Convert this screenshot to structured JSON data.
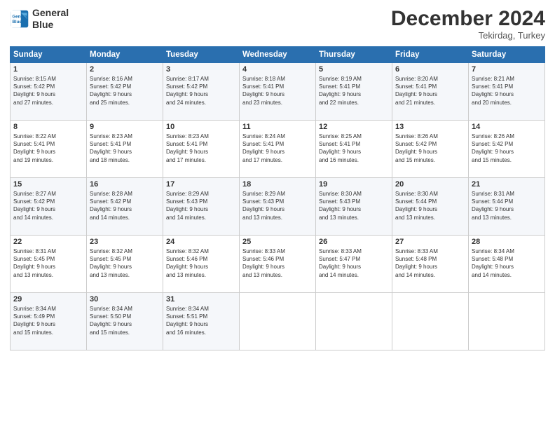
{
  "logo": {
    "line1": "General",
    "line2": "Blue"
  },
  "title": "December 2024",
  "location": "Tekirdag, Turkey",
  "days_header": [
    "Sunday",
    "Monday",
    "Tuesday",
    "Wednesday",
    "Thursday",
    "Friday",
    "Saturday"
  ],
  "weeks": [
    [
      {
        "day": "1",
        "text": "Sunrise: 8:15 AM\nSunset: 5:42 PM\nDaylight: 9 hours\nand 27 minutes."
      },
      {
        "day": "2",
        "text": "Sunrise: 8:16 AM\nSunset: 5:42 PM\nDaylight: 9 hours\nand 25 minutes."
      },
      {
        "day": "3",
        "text": "Sunrise: 8:17 AM\nSunset: 5:42 PM\nDaylight: 9 hours\nand 24 minutes."
      },
      {
        "day": "4",
        "text": "Sunrise: 8:18 AM\nSunset: 5:41 PM\nDaylight: 9 hours\nand 23 minutes."
      },
      {
        "day": "5",
        "text": "Sunrise: 8:19 AM\nSunset: 5:41 PM\nDaylight: 9 hours\nand 22 minutes."
      },
      {
        "day": "6",
        "text": "Sunrise: 8:20 AM\nSunset: 5:41 PM\nDaylight: 9 hours\nand 21 minutes."
      },
      {
        "day": "7",
        "text": "Sunrise: 8:21 AM\nSunset: 5:41 PM\nDaylight: 9 hours\nand 20 minutes."
      }
    ],
    [
      {
        "day": "8",
        "text": "Sunrise: 8:22 AM\nSunset: 5:41 PM\nDaylight: 9 hours\nand 19 minutes."
      },
      {
        "day": "9",
        "text": "Sunrise: 8:23 AM\nSunset: 5:41 PM\nDaylight: 9 hours\nand 18 minutes."
      },
      {
        "day": "10",
        "text": "Sunrise: 8:23 AM\nSunset: 5:41 PM\nDaylight: 9 hours\nand 17 minutes."
      },
      {
        "day": "11",
        "text": "Sunrise: 8:24 AM\nSunset: 5:41 PM\nDaylight: 9 hours\nand 17 minutes."
      },
      {
        "day": "12",
        "text": "Sunrise: 8:25 AM\nSunset: 5:41 PM\nDaylight: 9 hours\nand 16 minutes."
      },
      {
        "day": "13",
        "text": "Sunrise: 8:26 AM\nSunset: 5:42 PM\nDaylight: 9 hours\nand 15 minutes."
      },
      {
        "day": "14",
        "text": "Sunrise: 8:26 AM\nSunset: 5:42 PM\nDaylight: 9 hours\nand 15 minutes."
      }
    ],
    [
      {
        "day": "15",
        "text": "Sunrise: 8:27 AM\nSunset: 5:42 PM\nDaylight: 9 hours\nand 14 minutes."
      },
      {
        "day": "16",
        "text": "Sunrise: 8:28 AM\nSunset: 5:42 PM\nDaylight: 9 hours\nand 14 minutes."
      },
      {
        "day": "17",
        "text": "Sunrise: 8:29 AM\nSunset: 5:43 PM\nDaylight: 9 hours\nand 14 minutes."
      },
      {
        "day": "18",
        "text": "Sunrise: 8:29 AM\nSunset: 5:43 PM\nDaylight: 9 hours\nand 13 minutes."
      },
      {
        "day": "19",
        "text": "Sunrise: 8:30 AM\nSunset: 5:43 PM\nDaylight: 9 hours\nand 13 minutes."
      },
      {
        "day": "20",
        "text": "Sunrise: 8:30 AM\nSunset: 5:44 PM\nDaylight: 9 hours\nand 13 minutes."
      },
      {
        "day": "21",
        "text": "Sunrise: 8:31 AM\nSunset: 5:44 PM\nDaylight: 9 hours\nand 13 minutes."
      }
    ],
    [
      {
        "day": "22",
        "text": "Sunrise: 8:31 AM\nSunset: 5:45 PM\nDaylight: 9 hours\nand 13 minutes."
      },
      {
        "day": "23",
        "text": "Sunrise: 8:32 AM\nSunset: 5:45 PM\nDaylight: 9 hours\nand 13 minutes."
      },
      {
        "day": "24",
        "text": "Sunrise: 8:32 AM\nSunset: 5:46 PM\nDaylight: 9 hours\nand 13 minutes."
      },
      {
        "day": "25",
        "text": "Sunrise: 8:33 AM\nSunset: 5:46 PM\nDaylight: 9 hours\nand 13 minutes."
      },
      {
        "day": "26",
        "text": "Sunrise: 8:33 AM\nSunset: 5:47 PM\nDaylight: 9 hours\nand 14 minutes."
      },
      {
        "day": "27",
        "text": "Sunrise: 8:33 AM\nSunset: 5:48 PM\nDaylight: 9 hours\nand 14 minutes."
      },
      {
        "day": "28",
        "text": "Sunrise: 8:34 AM\nSunset: 5:48 PM\nDaylight: 9 hours\nand 14 minutes."
      }
    ],
    [
      {
        "day": "29",
        "text": "Sunrise: 8:34 AM\nSunset: 5:49 PM\nDaylight: 9 hours\nand 15 minutes."
      },
      {
        "day": "30",
        "text": "Sunrise: 8:34 AM\nSunset: 5:50 PM\nDaylight: 9 hours\nand 15 minutes."
      },
      {
        "day": "31",
        "text": "Sunrise: 8:34 AM\nSunset: 5:51 PM\nDaylight: 9 hours\nand 16 minutes."
      },
      null,
      null,
      null,
      null
    ]
  ]
}
